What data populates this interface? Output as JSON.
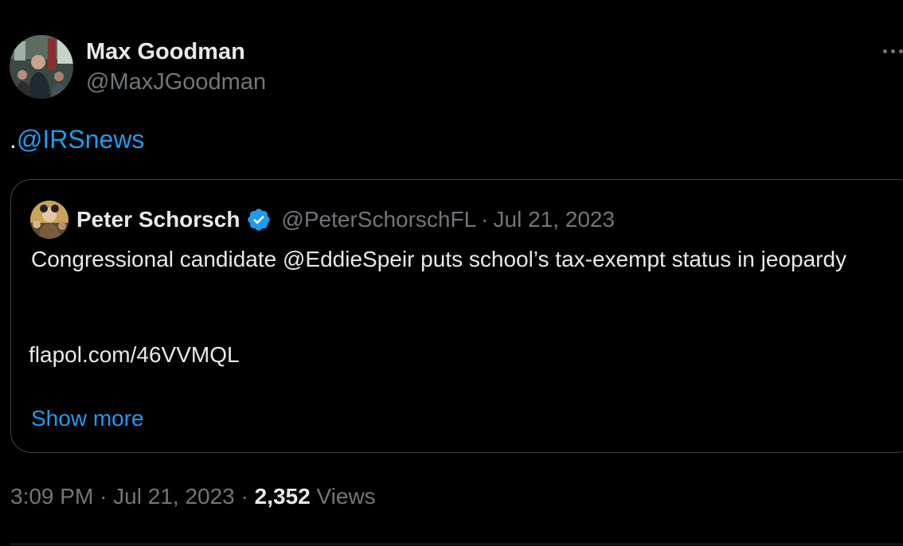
{
  "tweet": {
    "author": {
      "display_name": "Max Goodman",
      "handle": "@MaxJGoodman",
      "avatar_icon": "person-avatar"
    },
    "text_prefix": ".",
    "mention": "@IRSnews",
    "more_icon": "more-dots-icon"
  },
  "quoted_tweet": {
    "author": {
      "display_name": "Peter Schorsch",
      "handle": "@PeterSchorschFL",
      "avatar_icon": "person-avatar",
      "verified_icon": "verified-badge-icon"
    },
    "separator": "·",
    "date": "Jul 21, 2023",
    "body": "Congressional candidate @EddieSpeir puts school’s tax-exempt status in jeopardy",
    "link": "flapol.com/46VVMQL",
    "show_more": "Show more"
  },
  "meta": {
    "time": "3:09 PM",
    "separator1": "·",
    "date": "Jul 21, 2023",
    "separator2": "·",
    "views_count": "2,352",
    "views_label": "Views"
  },
  "colors": {
    "background": "#000000",
    "text": "#e7e9ea",
    "muted": "#71767b",
    "link": "#1d9bf0",
    "border": "#3e4144"
  }
}
